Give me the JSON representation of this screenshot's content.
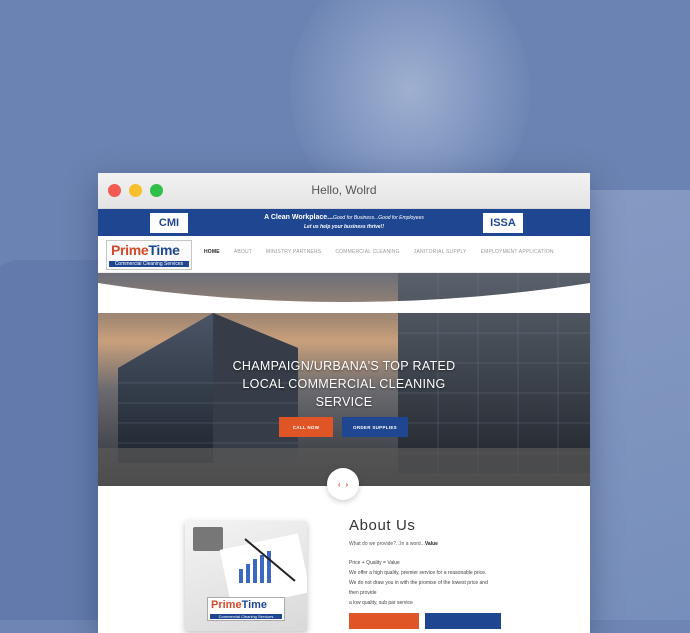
{
  "window": {
    "title": "Hello, Wolrd"
  },
  "topbar": {
    "left_badge": "CMI",
    "right_badge": "ISSA",
    "tagline_main": "A Clean Workplace...",
    "tagline_small": "Good for Business...Good for Employees",
    "tagline_sub": "Let us help your business thrive!!"
  },
  "logo": {
    "name_a": "Prime",
    "name_b": "Time",
    "sub": "Commercial Cleaning Services"
  },
  "nav": [
    "HOME",
    "ABOUT",
    "MINISTRY PARTNERS",
    "COMMERCIAL CLEANING",
    "JANITORIAL SUPPLY",
    "EMPLOYMENT APPLICATION"
  ],
  "hero": {
    "headline": "CHAMPAIGN/URBANA'S TOP RATED LOCAL COMMERCIAL CLEANING SERVICE",
    "call_label": "CALL NOW",
    "order_label": "ORDER SUPPLIES",
    "prev": "‹",
    "next": "›"
  },
  "about": {
    "title": "About Us",
    "question": "What do we provide?...In a word...",
    "answer": "Value",
    "lines": [
      "Price + Quality = Value",
      "We offer a high quality, premier service for a reasonable price.",
      "We do not draw you in with the promise of the lowest price and",
      "then provide",
      "a low quality, sub par service"
    ]
  },
  "colors": {
    "brand_blue": "#1f4791",
    "accent_orange": "#e05526"
  }
}
